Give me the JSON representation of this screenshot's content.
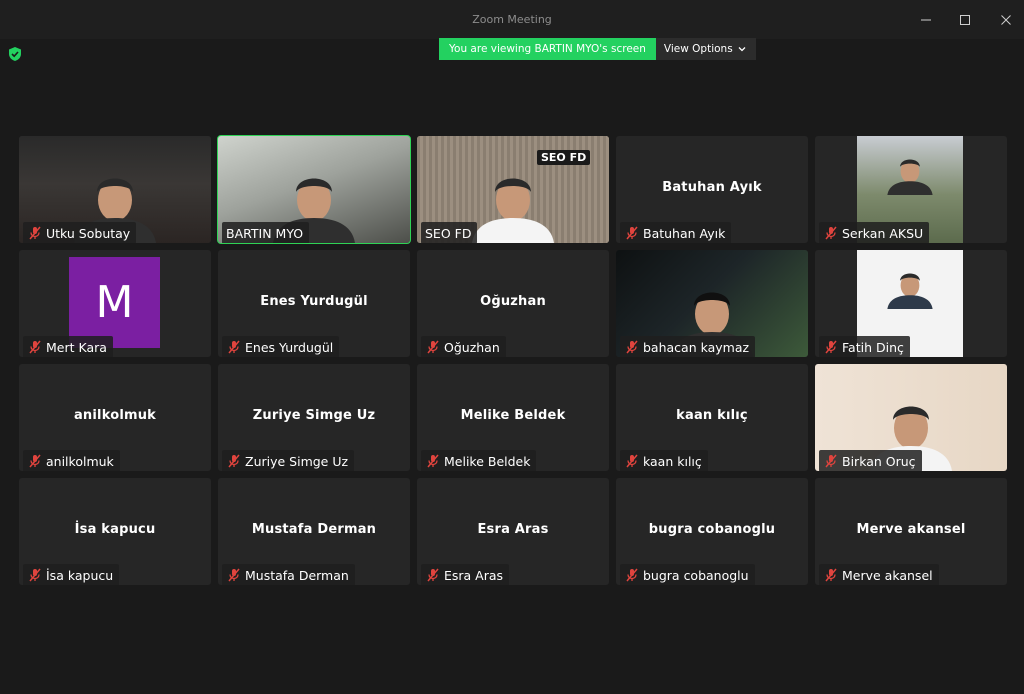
{
  "window": {
    "title": "Zoom Meeting",
    "controls": [
      "minimize",
      "maximize",
      "close"
    ]
  },
  "banner": {
    "text": "You are viewing BARTIN MYO's screen",
    "view_options_label": "View Options"
  },
  "colors": {
    "banner_green": "#23d160",
    "active_speaker_border": "#2fd355",
    "muted_icon": "#e0443e",
    "avatar_purple": "#7b1fa2"
  },
  "participants": [
    {
      "name": "Utku Sobutay",
      "video": true,
      "muted": true,
      "active": false
    },
    {
      "name": "BARTIN MYO",
      "video": true,
      "muted": false,
      "active": true
    },
    {
      "name": "SEO FD",
      "video": true,
      "muted": false,
      "active": false
    },
    {
      "name": "Batuhan Ayık",
      "video": false,
      "muted": true,
      "active": false
    },
    {
      "name": "Serkan AKSU",
      "video": true,
      "muted": true,
      "active": false
    },
    {
      "name": "Mert Kara",
      "video": false,
      "avatar_letter": "M",
      "muted": true,
      "active": false
    },
    {
      "name": "Enes Yurdugül",
      "video": false,
      "muted": true,
      "active": false
    },
    {
      "name": "Oğuzhan",
      "video": false,
      "muted": true,
      "active": false
    },
    {
      "name": "bahacan kaymaz",
      "video": true,
      "muted": true,
      "active": false
    },
    {
      "name": "Fatih Dinç",
      "video": true,
      "muted": true,
      "active": false
    },
    {
      "name": "anilkolmuk",
      "video": false,
      "muted": true,
      "active": false
    },
    {
      "name": "Zuriye Simge Uz",
      "video": false,
      "muted": true,
      "active": false
    },
    {
      "name": "Melike Beldek",
      "video": false,
      "muted": true,
      "active": false
    },
    {
      "name": "kaan kılıç",
      "video": false,
      "muted": true,
      "active": false
    },
    {
      "name": "Birkan Oruç",
      "video": true,
      "muted": true,
      "active": false
    },
    {
      "name": "İsa kapucu",
      "video": false,
      "muted": true,
      "active": false
    },
    {
      "name": "Mustafa Derman",
      "video": false,
      "muted": true,
      "active": false
    },
    {
      "name": "Esra Aras",
      "video": false,
      "muted": true,
      "active": false
    },
    {
      "name": "bugra cobanoglu",
      "video": false,
      "muted": true,
      "active": false
    },
    {
      "name": "Merve akansel",
      "video": false,
      "muted": true,
      "active": false
    }
  ]
}
